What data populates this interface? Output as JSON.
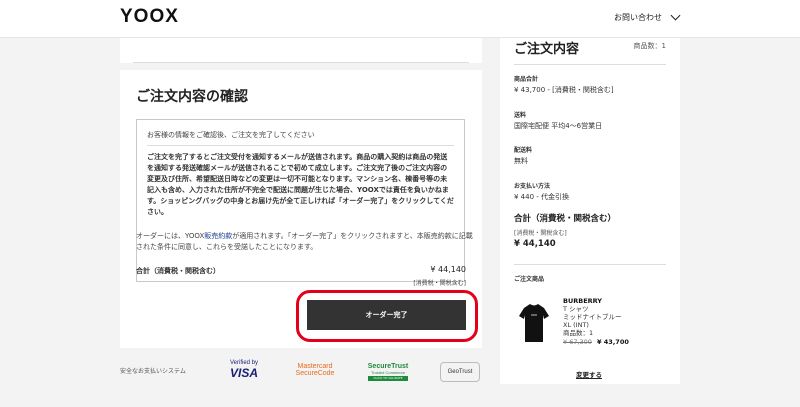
{
  "header": {
    "logo": "YOOX",
    "contact_label": "お問い合わせ"
  },
  "confirm": {
    "title": "ご注文内容の確認",
    "notice_head": "お客様の情報をご確認後、ご注文を完了してください",
    "notice_body": "ご注文を完了するとご注文受付を通知するメールが送信されます。商品の購入契約は商品の発送を通知する発送確認メールが送信されることで初めて成立します。ご注文完了後のご注文内容の変更及び住所、希望配送日時などの変更は一切不可能となります。マンション名、棟番号等の未記入も含め、入力された住所が不完全で配送に問題が生じた場合、YOOXでは責任を負いかねます。ショッピングバッグの中身とお届け先が全て正しければ「オーダー完了」をクリックしてください。",
    "terms_prefix": "オーダーには、YOOX",
    "terms_link": "販売約款",
    "terms_suffix": "が適用されます。「オーダー完了」をクリックされますと、本販売約款に記載された条件に同意し、これらを受諾したことになります。",
    "total_label": "合計（消費税・関税含む）",
    "total_value": "¥ 44,140",
    "total_note": "[消費税・関税含む]",
    "order_button": "オーダー完了"
  },
  "payment": {
    "label": "安全なお支払いシステム",
    "visa_line1": "Verified by",
    "visa_line2": "VISA",
    "mc_line1": "Mastercard",
    "mc_line2": "SecureCode",
    "st_line1": "SecureTrust",
    "st_line2": "Trusted Commerce",
    "st_line3": "CLICK TO VALIDATE",
    "geo_line1": "GeoTrust"
  },
  "summary": {
    "title": "ご注文内容",
    "count": "商品数：1",
    "items_total_label": "商品合計",
    "items_total_value": "¥ 43,700 - [消費税・関税含む]",
    "shipping_label": "送料",
    "shipping_value": "国際宅配便 平均4〜6営業日",
    "delivery_fee_label": "配送料",
    "delivery_fee_value": "無料",
    "payment_method_label": "お支払い方法",
    "payment_method_value": "¥ 440 - 代金引換",
    "grand_total_label": "合計（消費税・関税含む）",
    "grand_total_note": "[消費税・関税含む]",
    "grand_total_value": "¥ 44,140",
    "products_label": "ご注文商品",
    "product": {
      "brand": "BURBERRY",
      "type": "T シャツ",
      "color": "ミッドナイトブルー",
      "size": "XL (INT)",
      "qty": "商品数：1",
      "old_price": "¥ 67,300",
      "new_price": "¥ 43,700"
    },
    "change_link": "変更する"
  },
  "colors": {
    "highlight": "#e4001b",
    "button": "#333333",
    "link": "#1b3d8f"
  }
}
